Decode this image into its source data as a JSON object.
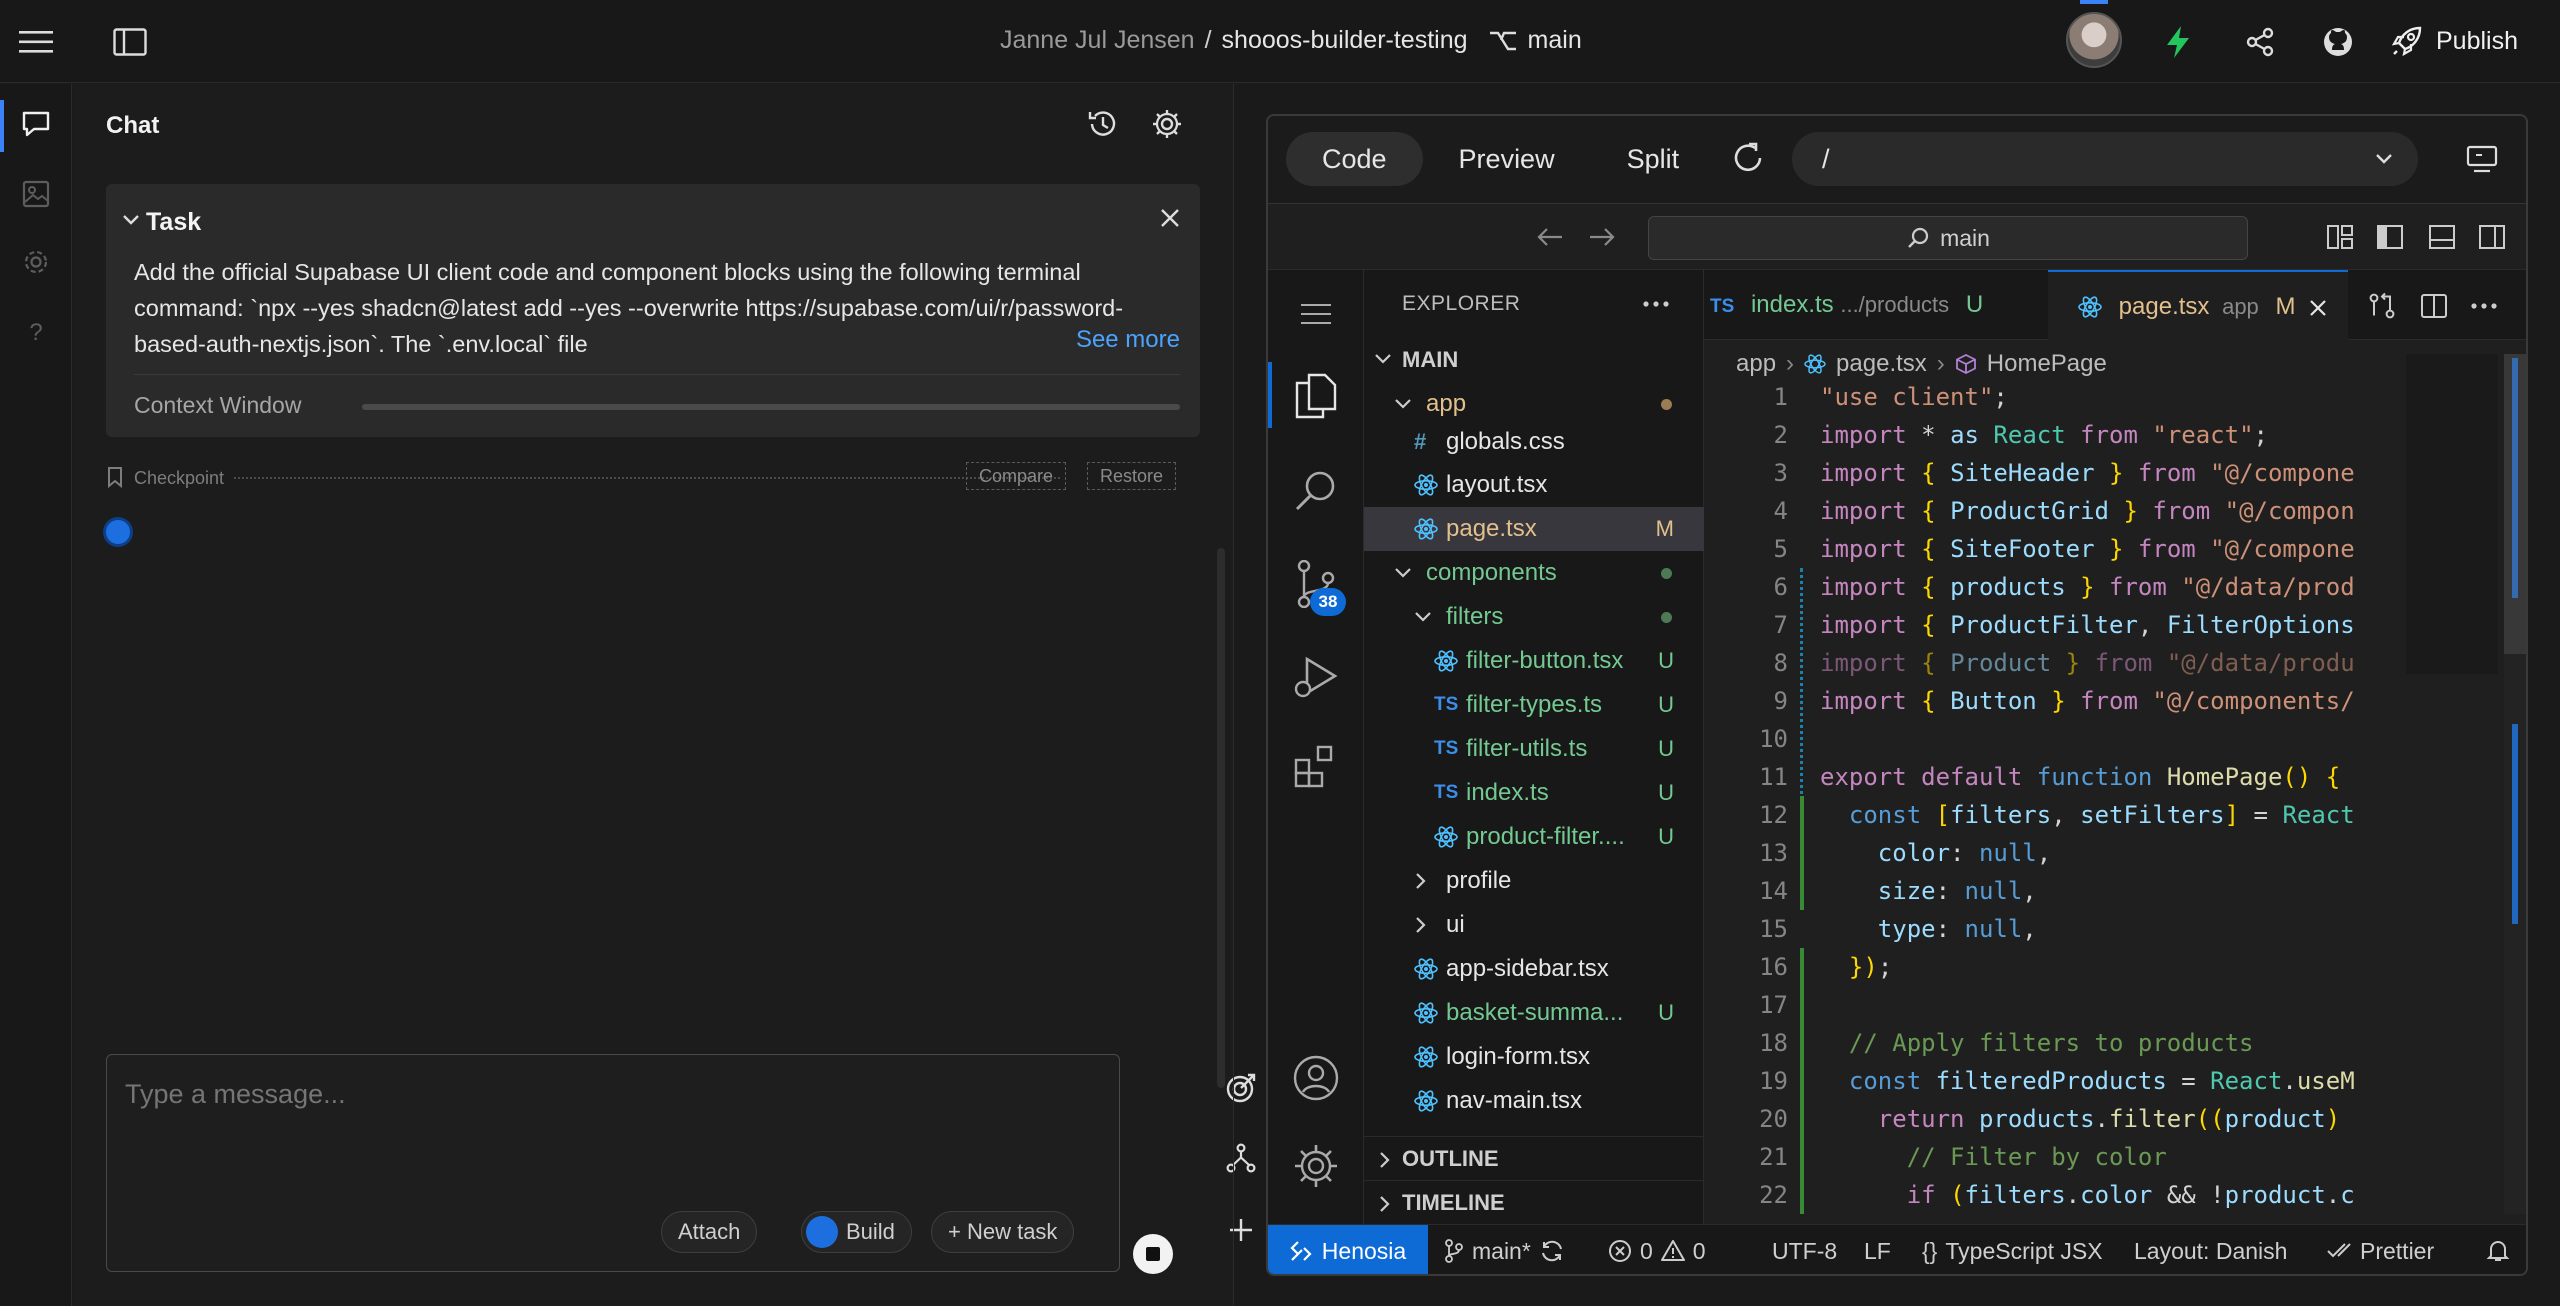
{
  "topbar": {
    "owner": "Janne Jul Jensen",
    "separator": "/",
    "repo": "shooos-builder-testing",
    "branch": "main",
    "publish_label": "Publish"
  },
  "chat": {
    "title": "Chat",
    "task": {
      "title": "Task",
      "body": "Add the official Supabase UI client code and component blocks using the following terminal command: `npx --yes shadcn@latest add --yes --overwrite https://supabase.com/ui/r/password-based-auth-nextjs.json`. The `.env.local` file",
      "see_more": "See more",
      "context_label": "Context Window"
    },
    "checkpoint": {
      "label": "Checkpoint",
      "compare": "Compare",
      "restore": "Restore"
    },
    "composer": {
      "placeholder": "Type a message...",
      "attach": "Attach",
      "build": "Build",
      "new_task": "+ New task"
    }
  },
  "ide": {
    "modes": {
      "code": "Code",
      "preview": "Preview",
      "split": "Split"
    },
    "url": "/",
    "command_center": "main",
    "explorer": {
      "title": "EXPLORER",
      "root": "MAIN",
      "items": [
        {
          "name": "app",
          "status": "",
          "kind": "folder-open"
        },
        {
          "name": "globals.css",
          "status": "",
          "kind": "css"
        },
        {
          "name": "layout.tsx",
          "status": "",
          "kind": "react"
        },
        {
          "name": "page.tsx",
          "status": "M",
          "kind": "react"
        },
        {
          "name": "components",
          "status": "",
          "kind": "folder-open"
        },
        {
          "name": "filters",
          "status": "",
          "kind": "folder-open"
        },
        {
          "name": "filter-button.tsx",
          "status": "U",
          "kind": "react"
        },
        {
          "name": "filter-types.ts",
          "status": "U",
          "kind": "ts"
        },
        {
          "name": "filter-utils.ts",
          "status": "U",
          "kind": "ts"
        },
        {
          "name": "index.ts",
          "status": "U",
          "kind": "ts"
        },
        {
          "name": "product-filter....",
          "status": "U",
          "kind": "react"
        },
        {
          "name": "profile",
          "status": "",
          "kind": "folder"
        },
        {
          "name": "ui",
          "status": "",
          "kind": "folder"
        },
        {
          "name": "app-sidebar.tsx",
          "status": "",
          "kind": "react"
        },
        {
          "name": "basket-summa...",
          "status": "U",
          "kind": "react"
        },
        {
          "name": "login-form.tsx",
          "status": "",
          "kind": "react"
        },
        {
          "name": "nav-main.tsx",
          "status": "",
          "kind": "react"
        }
      ],
      "outline": "OUTLINE",
      "timeline": "TIMELINE",
      "ts_glyph": "TS",
      "css_glyph": "#"
    },
    "tabs": [
      {
        "name": "index.ts",
        "path": ".../products",
        "status": "U"
      },
      {
        "name": "page.tsx",
        "path": "app",
        "status": "M"
      }
    ],
    "breadcrumb": {
      "folder": "app",
      "file": "page.tsx",
      "symbol": "HomePage"
    },
    "source_lines": [
      "\"use client\";",
      "import * as React from \"react\";",
      "import { SiteHeader } from \"@/compone",
      "import { ProductGrid } from \"@/compon",
      "import { SiteFooter } from \"@/compone",
      "import { products } from \"@/data/prod",
      "import { ProductFilter, FilterOptions",
      "import { Product } from \"@/data/produ",
      "import { Button } from \"@/components/",
      "",
      "export default function HomePage() {",
      "  const [filters, setFilters] = React",
      "    color: null,",
      "    size: null,",
      "    type: null,",
      "  });",
      "",
      "  // Apply filters to products",
      "  const filteredProducts = React.useM",
      "    return products.filter((product)",
      "      // Filter by color",
      "      if (filters.color && !product.c"
    ],
    "status": {
      "remote": "Henosia",
      "branch": "main*",
      "errors": "0",
      "warnings": "0",
      "encoding": "UTF-8",
      "eol": "LF",
      "language": "TypeScript JSX",
      "layout": "Layout: Danish",
      "formatter": "Prettier"
    }
  },
  "colors": {
    "accent": "#0e6bd6",
    "modified": "#e2c08d",
    "untracked": "#73c991",
    "link": "#4aa3ff"
  }
}
